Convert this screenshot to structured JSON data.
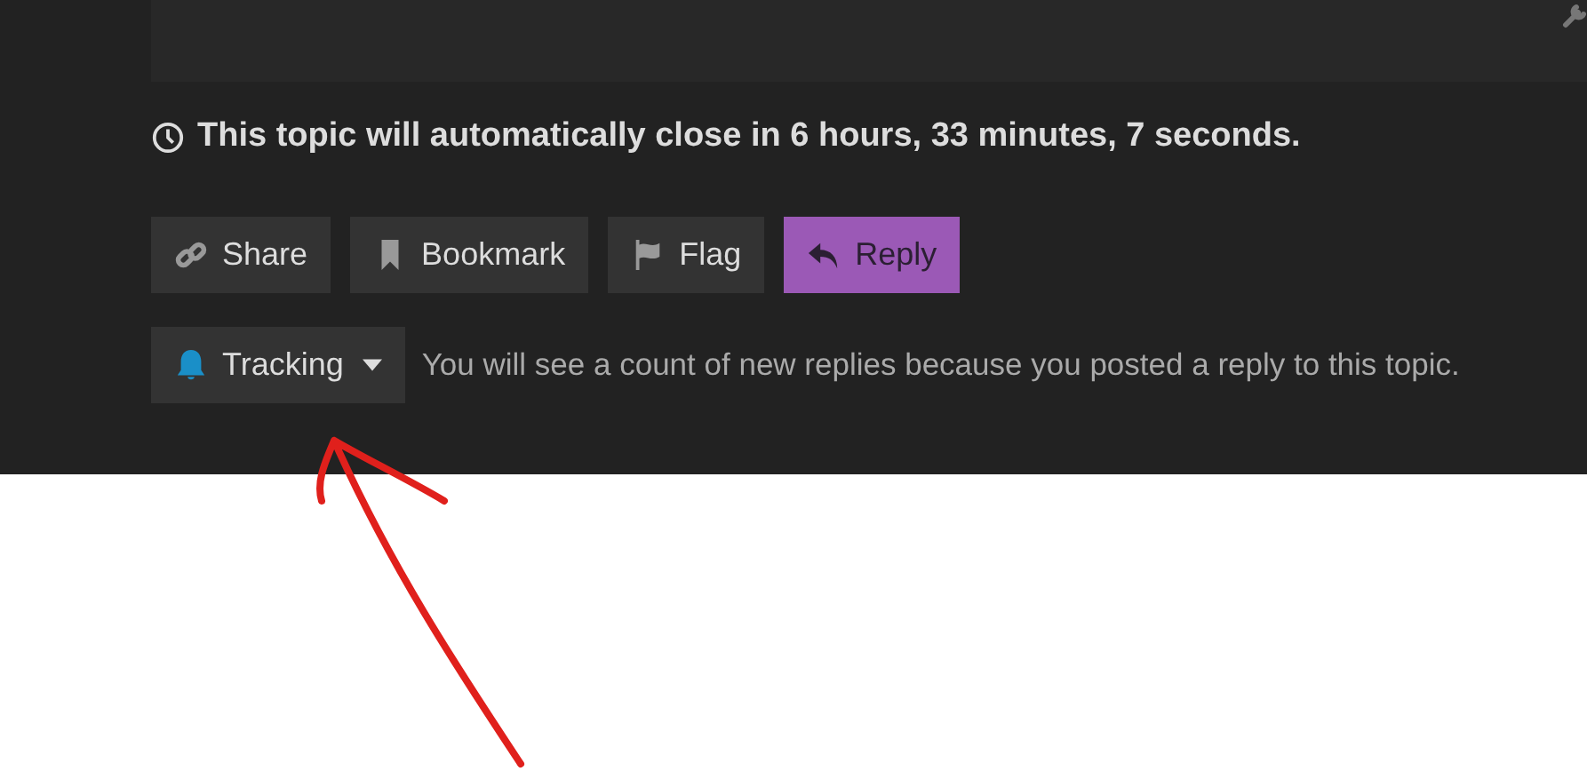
{
  "topic_timer": {
    "text": "This topic will automatically close in 6 hours, 33 minutes, 7 seconds."
  },
  "buttons": [
    {
      "label": "Share",
      "kind": "default"
    },
    {
      "label": "Bookmark",
      "kind": "default"
    },
    {
      "label": "Flag",
      "kind": "default"
    },
    {
      "label": "Reply",
      "kind": "primary"
    }
  ],
  "notification": {
    "label": "Tracking",
    "description": "You will see a count of new replies because you posted a reply to this topic."
  }
}
